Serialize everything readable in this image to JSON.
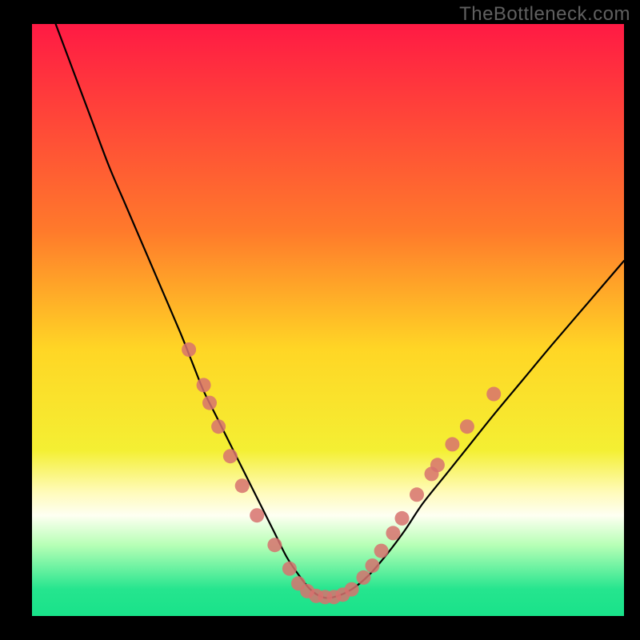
{
  "watermark": "TheBottleneck.com",
  "chart_data": {
    "type": "line",
    "title": "",
    "xlabel": "",
    "ylabel": "",
    "xlim": [
      0,
      100
    ],
    "ylim": [
      0,
      100
    ],
    "grid": false,
    "legend": null,
    "background_gradient": {
      "stops": [
        {
          "offset": 0.0,
          "color": "#ff1a44"
        },
        {
          "offset": 0.35,
          "color": "#ff7a2b"
        },
        {
          "offset": 0.55,
          "color": "#ffd625"
        },
        {
          "offset": 0.72,
          "color": "#f4ef33"
        },
        {
          "offset": 0.79,
          "color": "#fffbb8"
        },
        {
          "offset": 0.83,
          "color": "#fefff2"
        },
        {
          "offset": 0.88,
          "color": "#b7ffb6"
        },
        {
          "offset": 0.955,
          "color": "#25e58e"
        },
        {
          "offset": 1.0,
          "color": "#19e28a"
        }
      ]
    },
    "series": [
      {
        "name": "bottleneck-curve",
        "x": [
          4,
          7,
          10,
          13,
          16,
          19,
          22,
          25,
          27,
          29,
          31,
          33,
          35,
          37,
          39,
          41,
          43,
          45,
          47,
          49,
          51,
          54,
          57,
          60,
          63,
          66,
          70,
          74,
          78,
          83,
          88,
          94,
          100
        ],
        "y": [
          100,
          92,
          84,
          76,
          69,
          62,
          55,
          48,
          43,
          38,
          34,
          30,
          26,
          22,
          18,
          14,
          10,
          7,
          4.5,
          3.2,
          3.2,
          4.5,
          7,
          10.5,
          14.5,
          19,
          24,
          29,
          34,
          40,
          46,
          53,
          60
        ]
      }
    ],
    "markers": {
      "name": "highlight-points",
      "color": "#d7726f",
      "radius": 9,
      "points": [
        {
          "arm": "left",
          "x": 26.5,
          "y": 45.0
        },
        {
          "arm": "left",
          "x": 29.0,
          "y": 39.0
        },
        {
          "arm": "left",
          "x": 30.0,
          "y": 36.0
        },
        {
          "arm": "left",
          "x": 31.5,
          "y": 32.0
        },
        {
          "arm": "left",
          "x": 33.5,
          "y": 27.0
        },
        {
          "arm": "left",
          "x": 35.5,
          "y": 22.0
        },
        {
          "arm": "left",
          "x": 38.0,
          "y": 17.0
        },
        {
          "arm": "left",
          "x": 41.0,
          "y": 12.0
        },
        {
          "arm": "left",
          "x": 43.5,
          "y": 8.0
        },
        {
          "arm": "flat",
          "x": 45.0,
          "y": 5.5
        },
        {
          "arm": "flat",
          "x": 46.5,
          "y": 4.2
        },
        {
          "arm": "flat",
          "x": 48.0,
          "y": 3.4
        },
        {
          "arm": "flat",
          "x": 49.5,
          "y": 3.2
        },
        {
          "arm": "flat",
          "x": 51.0,
          "y": 3.2
        },
        {
          "arm": "flat",
          "x": 52.5,
          "y": 3.6
        },
        {
          "arm": "flat",
          "x": 54.0,
          "y": 4.5
        },
        {
          "arm": "right",
          "x": 56.0,
          "y": 6.5
        },
        {
          "arm": "right",
          "x": 57.5,
          "y": 8.5
        },
        {
          "arm": "right",
          "x": 59.0,
          "y": 11.0
        },
        {
          "arm": "right",
          "x": 61.0,
          "y": 14.0
        },
        {
          "arm": "right",
          "x": 62.5,
          "y": 16.5
        },
        {
          "arm": "right",
          "x": 65.0,
          "y": 20.5
        },
        {
          "arm": "right",
          "x": 67.5,
          "y": 24.0
        },
        {
          "arm": "right",
          "x": 68.5,
          "y": 25.5
        },
        {
          "arm": "right",
          "x": 71.0,
          "y": 29.0
        },
        {
          "arm": "right",
          "x": 73.5,
          "y": 32.0
        },
        {
          "arm": "right",
          "x": 78.0,
          "y": 37.5
        }
      ]
    }
  }
}
